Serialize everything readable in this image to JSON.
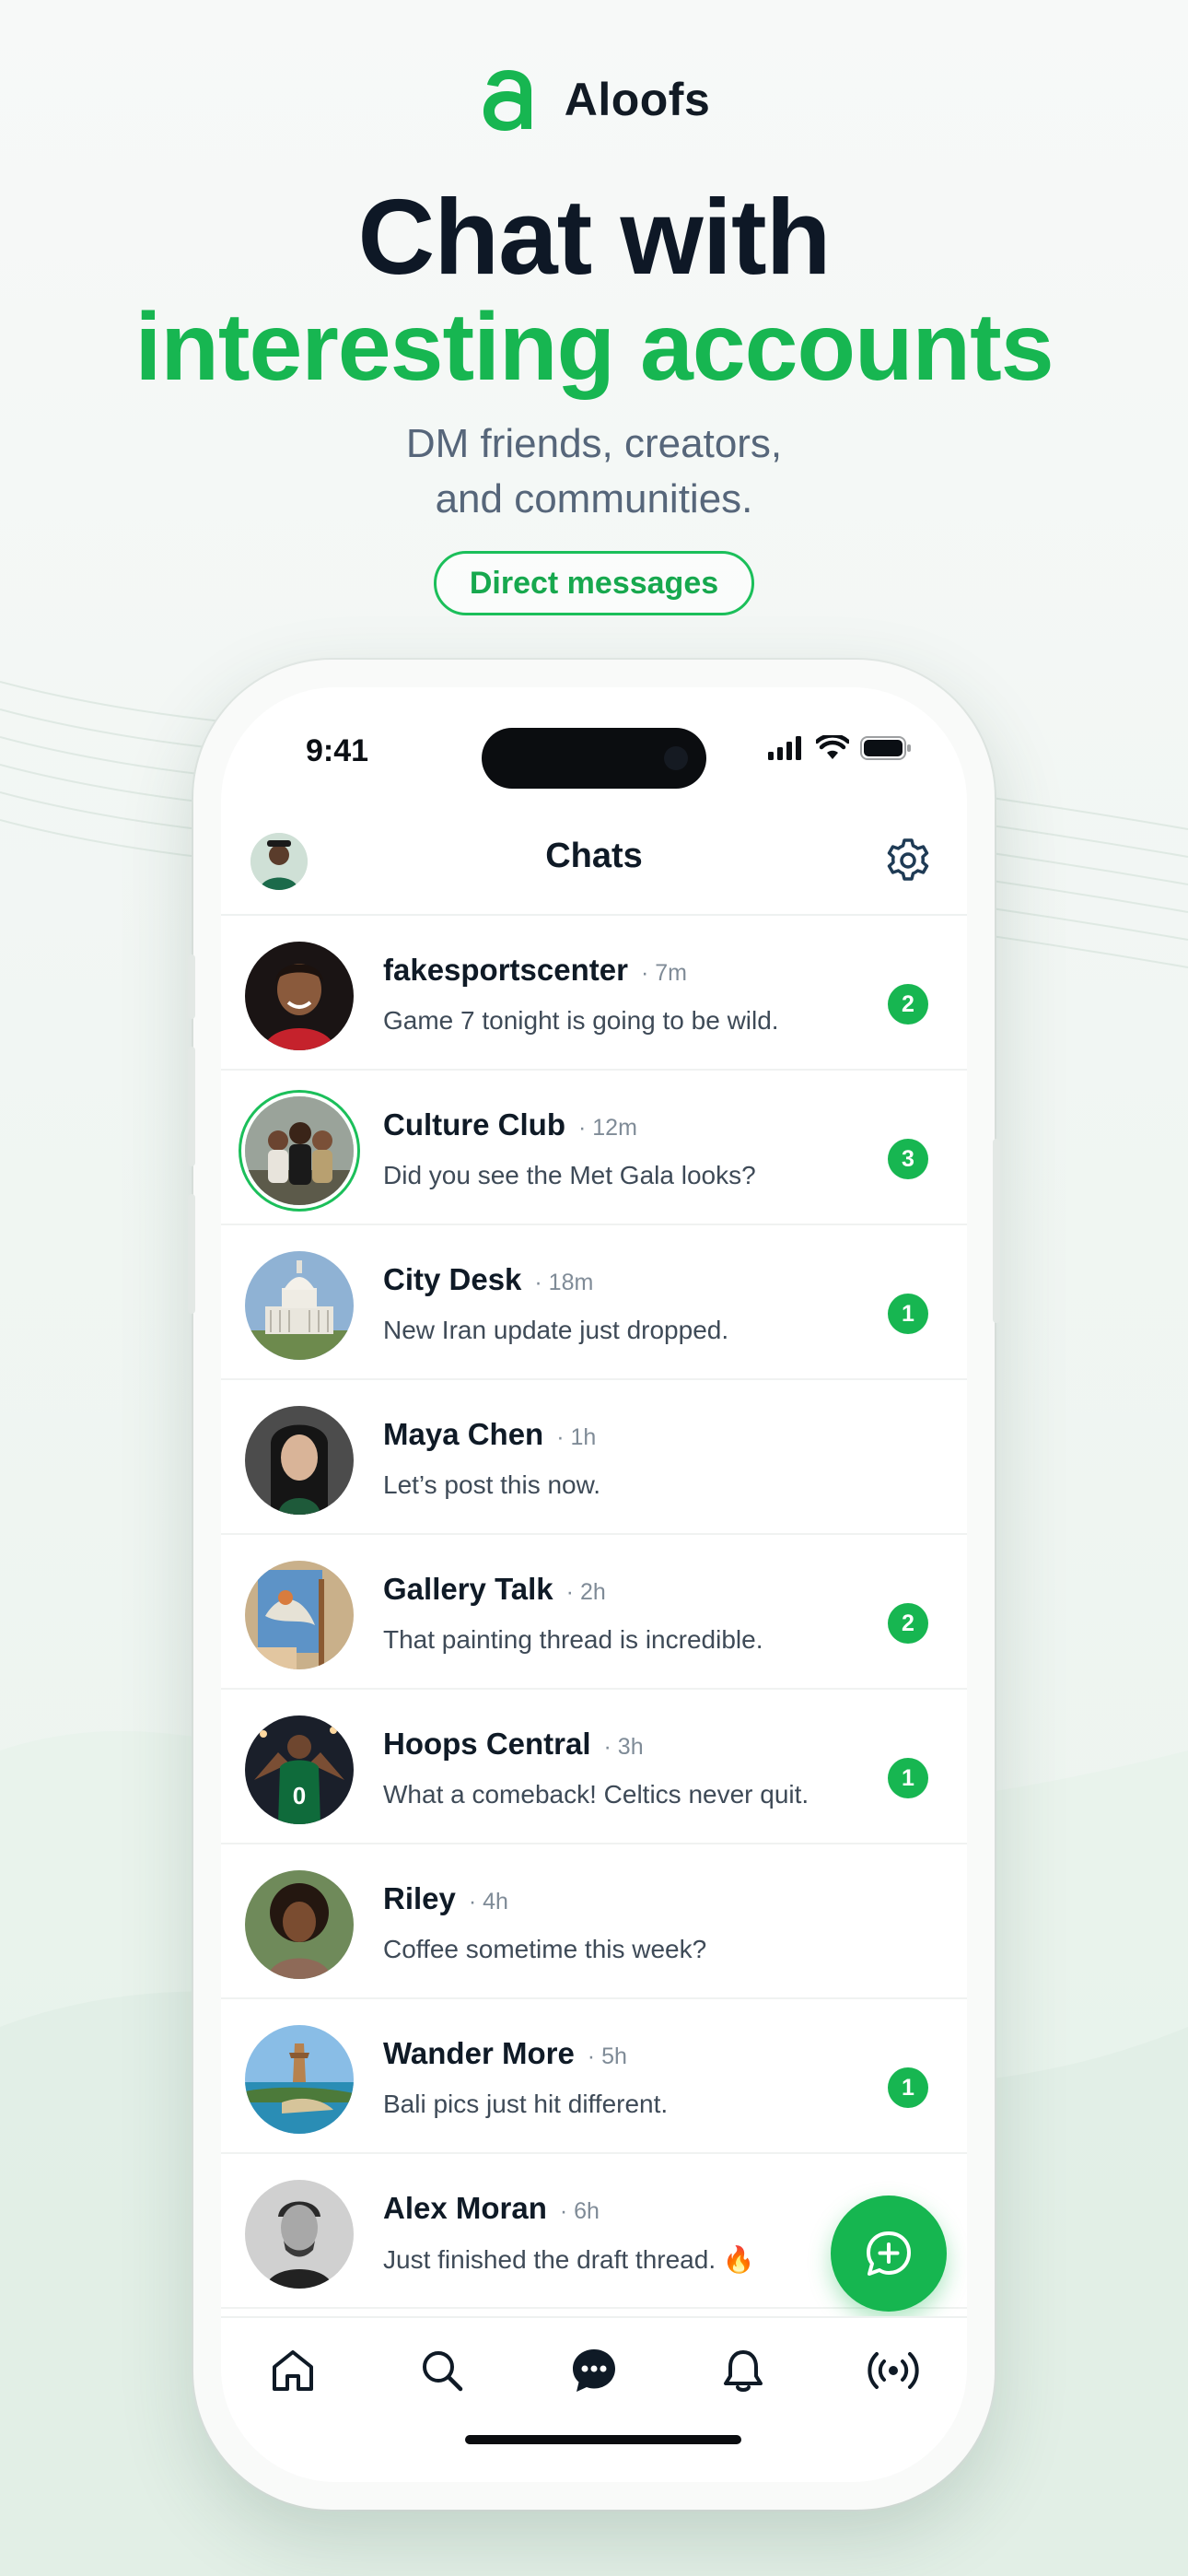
{
  "app": {
    "brand": "Aloofs",
    "headline_line1": "Chat with",
    "headline_line2": "interesting accounts",
    "subtitle_line1": "DM friends, creators,",
    "subtitle_line2": "and communities.",
    "pill": "Direct messages",
    "accent_color": "#17b651"
  },
  "status_bar": {
    "time": "9:41"
  },
  "nav": {
    "title": "Chats"
  },
  "chats": [
    {
      "name": "fakesportscenter",
      "time": "· 7m",
      "message": "Game 7 tonight is going to be wild.",
      "unread": "2"
    },
    {
      "name": "Culture Club",
      "time": "· 12m",
      "message": "Did you see the Met Gala looks?",
      "unread": "3"
    },
    {
      "name": "City Desk",
      "time": "· 18m",
      "message": "New Iran update just dropped.",
      "unread": "1"
    },
    {
      "name": "Maya Chen",
      "time": "· 1h",
      "message": "Let’s post this now.",
      "unread": ""
    },
    {
      "name": "Gallery Talk",
      "time": "· 2h",
      "message": "That painting thread is incredible.",
      "unread": "2"
    },
    {
      "name": "Hoops Central",
      "time": "· 3h",
      "message": "What a comeback! Celtics never quit.",
      "unread": "1"
    },
    {
      "name": "Riley",
      "time": "· 4h",
      "message": "Coffee sometime this week?",
      "unread": ""
    },
    {
      "name": "Wander More",
      "time": "· 5h",
      "message": "Bali pics just hit different.",
      "unread": "1"
    },
    {
      "name": "Alex Moran",
      "time": "· 6h",
      "message": "Just finished the draft thread. 🔥",
      "unread": ""
    }
  ],
  "tabs": [
    "home-icon",
    "search-icon",
    "chat-bubble-icon",
    "bell-icon",
    "broadcast-icon"
  ]
}
